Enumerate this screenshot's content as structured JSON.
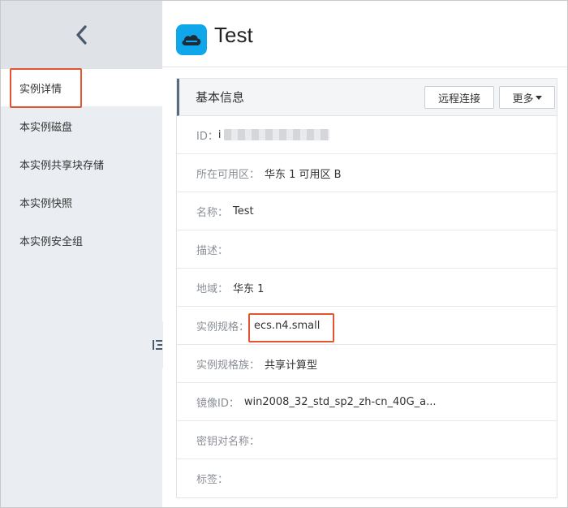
{
  "sidebar": {
    "back_icon": "chevron-left-icon",
    "items": [
      {
        "label": "实例详情",
        "active": true
      },
      {
        "label": "本实例磁盘",
        "active": false
      },
      {
        "label": "本实例共享块存储",
        "active": false
      },
      {
        "label": "本实例快照",
        "active": false
      },
      {
        "label": "本实例安全组",
        "active": false
      }
    ]
  },
  "header": {
    "icon": "cloud-server-icon",
    "title": "Test"
  },
  "panel": {
    "title": "基本信息",
    "remote_label": "远程连接",
    "more_label": "更多",
    "rows": [
      {
        "label": "ID：",
        "value": "i"
      },
      {
        "label": "所在可用区：",
        "value": "华东 1 可用区 B"
      },
      {
        "label": "名称：",
        "value": "Test"
      },
      {
        "label": "描述：",
        "value": ""
      },
      {
        "label": "地域：",
        "value": "华东 1"
      },
      {
        "label": "实例规格：",
        "value": "ecs.n4.small"
      },
      {
        "label": "实例规格族：",
        "value": "共享计算型"
      },
      {
        "label": "镜像ID：",
        "value": "win2008_32_std_sp2_zh-cn_40G_a..."
      },
      {
        "label": "密钥对名称：",
        "value": ""
      },
      {
        "label": "标签：",
        "value": ""
      }
    ]
  },
  "colors": {
    "highlight": "#e5542f",
    "accent": "#0fa7e9",
    "sidebar_bg": "#eaedf1"
  }
}
